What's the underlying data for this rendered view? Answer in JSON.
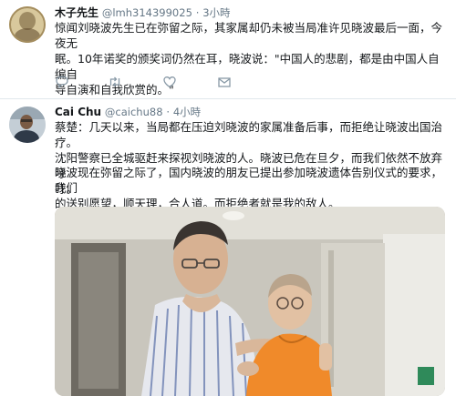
{
  "tweet1": {
    "name": "木子先生",
    "handle": "@lmh314399025",
    "time": "3小時",
    "text_lines": [
      "惊闻刘晓波先生已在弥留之际，其家属却仍未被当局准许见晓波最后一面，今夜无",
      "眠。10年诺奖的颁奖词仍然在耳，晓波说：\"中国人的悲剧，都是由中国人自编自",
      "导自演和自我欣赏的。\""
    ]
  },
  "tweet2": {
    "name": "Cai Chu",
    "handle": "@caichu88",
    "time": "4小時",
    "para1_lines": [
      "蔡楚：几天以来，当局都在压迫刘晓波的家属准备后事，而拒绝让晓波出国治疗。",
      "沈阳警察已全城驱赶来探视刘晓波的人。晓波已危在旦夕，而我们依然不放弃呼",
      "吁。"
    ],
    "para2_lines": [
      "晓波现在弥留之际了，国内晓波的朋友已提出参加晓波遗体告别仪式的要求，我们",
      "的送别愿望，顺天理，合人道。而拒绝者就是我的敌人。"
    ]
  },
  "icons": {
    "reply": "reply-icon",
    "retweet": "retweet-icon",
    "like": "heart-icon",
    "dm": "envelope-icon"
  },
  "colors": {
    "text": "#14171a",
    "muted": "#657786",
    "divider": "#e1e8ed",
    "icon": "#8899a6"
  }
}
